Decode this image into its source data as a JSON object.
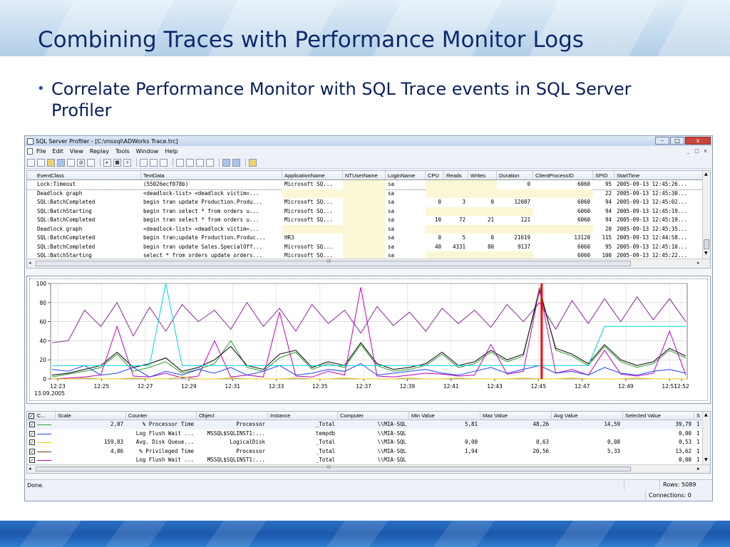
{
  "slide": {
    "title": "Combining Traces with Performance Monitor Logs",
    "bullet": "Correlate Performance Monitor with SQL Trace events in SQL Server Profiler"
  },
  "window": {
    "title": "SQL Server Profiler - [C:\\mssql\\ADWorks Trace.trc]",
    "buttons": {
      "minimize": "–",
      "maximize": "□",
      "close": "x"
    },
    "mdi_buttons": [
      "_",
      "□",
      "x"
    ],
    "menu": [
      "File",
      "Edit",
      "View",
      "Replay",
      "Tools",
      "Window",
      "Help"
    ],
    "toolbar_icons": [
      "save-icon",
      "new-trace-icon",
      "open-icon",
      "open-table-icon",
      "properties-icon",
      "find-icon",
      "clear-icon",
      "run-icon",
      "stop-icon",
      "pause-icon",
      "step-icon",
      "breakpoint-icon",
      "replay-icon",
      "columns-icon",
      "filter-icon",
      "group-icon",
      "monitor-icon",
      "help-icon"
    ]
  },
  "trace_grid": {
    "columns": [
      "EventClass",
      "TextData",
      "ApplicationName",
      "NTUserName",
      "LoginName",
      "CPU",
      "Reads",
      "Writes",
      "Duration",
      "ClientProcessID",
      "SPID",
      "StartTime"
    ],
    "rows": [
      [
        "Lock:Timeout",
        "(55026ecf078b)",
        "Microsoft SQ...",
        "",
        "sa",
        "",
        "",
        "",
        "0",
        "6060",
        "95",
        "2005-09-13 12:45:26..."
      ],
      [
        "Deadlock graph",
        "<deadlock-list>  <deadlock victim=...",
        "",
        "",
        "sa",
        "",
        "",
        "",
        "",
        "",
        "22",
        "2005-09-13 12:45:30..."
      ],
      [
        "SQL:BatchCompleted",
        "begin tran  update Production.Produ...",
        "Microsoft SQ...",
        "",
        "sa",
        "0",
        "3",
        "0",
        "12087",
        "6060",
        "94",
        "2005-09-13 12:45:02..."
      ],
      [
        "SQL:BatchStarting",
        "begin tran  select * from orders  u...",
        "Microsoft SQ...",
        "",
        "sa",
        "",
        "",
        "",
        "",
        "6060",
        "94",
        "2005-09-13 12:45:19..."
      ],
      [
        "SQL:BatchCompleted",
        "begin tran  select * from orders  u...",
        "Microsoft SQ...",
        "",
        "sa",
        "10",
        "72",
        "21",
        "121",
        "6060",
        "94",
        "2005-09-13 12:45:19..."
      ],
      [
        "Deadlock graph",
        "<deadlock-list>  <deadlock victim=...",
        "",
        "",
        "sa",
        "",
        "",
        "",
        "",
        "",
        "20",
        "2005-09-13 12:45:35..."
      ],
      [
        "SQL:BatchCompleted",
        "begin tran;update Production.Produc...",
        "HR3",
        "",
        "sa",
        "0",
        "5",
        "0",
        "21619",
        "13120",
        "115",
        "2005-09-13 12:44:58..."
      ],
      [
        "SQL:BatchCompleted",
        "begin tran  update Sales.SpecialOff...",
        "Microsoft SQ...",
        "",
        "sa",
        "40",
        "4331",
        "80",
        "9137",
        "6060",
        "95",
        "2005-09-13 12:45:10..."
      ],
      [
        "SQL:BatchStarting",
        "select * from orders  update orders...",
        "Microsoft SQ...",
        "",
        "sa",
        "",
        "",
        "",
        "",
        "6060",
        "100",
        "2005-09-13 12:45:22..."
      ]
    ],
    "scroll_grip": "III"
  },
  "chart_data": {
    "type": "line",
    "title": "",
    "xlabel": "",
    "ylabel": "",
    "ylim": [
      0,
      100
    ],
    "yticks": [
      "0",
      "20",
      "40",
      "60",
      "80",
      "100"
    ],
    "x_ticks": [
      "12:23",
      "12:25",
      "12:27",
      "12:29",
      "12:31",
      "12:33",
      "12:35",
      "12:37",
      "12:39",
      "12:41",
      "12:43",
      "12:45",
      "12:47",
      "12:49",
      "12:51",
      "12:52"
    ],
    "date_label": "13.09.2005",
    "grid": true,
    "legend": "none",
    "cursor_at": "12:45",
    "colors": {
      "cursor": "#ff0000",
      "green": "#2e9a2e",
      "magenta": "#c000c0",
      "purple": "#8a2a9a",
      "black": "#000000",
      "blue": "#2040ff",
      "cyan": "#00d0e8",
      "yellow": "#e8c800",
      "brown": "#6b3a1e"
    },
    "series": [
      {
        "color": "#8a2a9a",
        "values": [
          38,
          40,
          72,
          55,
          80,
          45,
          75,
          50,
          78,
          60,
          72,
          52,
          80,
          55,
          74,
          50,
          78,
          58,
          72,
          48,
          76,
          56,
          70,
          50,
          74,
          58,
          72,
          54,
          78,
          60,
          80,
          52,
          82,
          58,
          84,
          60,
          86,
          62,
          84,
          60
        ]
      },
      {
        "color": "#2e9a2e",
        "values": [
          2,
          5,
          8,
          12,
          26,
          8,
          12,
          18,
          6,
          10,
          16,
          40,
          12,
          8,
          22,
          28,
          10,
          16,
          12,
          36,
          14,
          8,
          10,
          14,
          26,
          12,
          16,
          28,
          18,
          24,
          96,
          30,
          24,
          14,
          34,
          18,
          12,
          16,
          30,
          22
        ]
      },
      {
        "color": "#000000",
        "values": [
          4,
          6,
          10,
          14,
          28,
          12,
          16,
          22,
          8,
          12,
          20,
          34,
          14,
          10,
          26,
          30,
          12,
          18,
          14,
          38,
          16,
          10,
          12,
          16,
          28,
          14,
          18,
          30,
          20,
          26,
          92,
          32,
          26,
          16,
          36,
          20,
          14,
          18,
          32,
          24
        ]
      },
      {
        "color": "#c000c0",
        "values": [
          0,
          1,
          2,
          4,
          55,
          3,
          2,
          6,
          1,
          3,
          40,
          2,
          4,
          2,
          70,
          3,
          2,
          8,
          4,
          96,
          3,
          2,
          4,
          6,
          5,
          3,
          4,
          36,
          5,
          8,
          94,
          6,
          10,
          4,
          30,
          5,
          3,
          6,
          50,
          4
        ]
      },
      {
        "color": "#2040ff",
        "values": [
          10,
          8,
          14,
          4,
          6,
          12,
          2,
          8,
          4,
          10,
          6,
          12,
          4,
          8,
          14,
          4,
          6,
          10,
          8,
          16,
          4,
          6,
          8,
          10,
          6,
          4,
          8,
          12,
          6,
          10,
          14,
          6,
          8,
          4,
          12,
          6,
          4,
          8,
          10,
          6
        ]
      },
      {
        "color": "#00d0e8",
        "values": [
          14,
          14,
          14,
          14,
          14,
          14,
          14,
          100,
          14,
          14,
          14,
          14,
          14,
          14,
          14,
          14,
          14,
          14,
          14,
          14,
          14,
          14,
          14,
          14,
          14,
          14,
          14,
          14,
          14,
          14,
          14,
          14,
          14,
          14,
          55,
          55,
          55,
          55,
          55,
          55
        ]
      },
      {
        "color": "#e8c800",
        "values": [
          0,
          0,
          1,
          0,
          0,
          1,
          0,
          0,
          2,
          0,
          0,
          1,
          0,
          0,
          0,
          1,
          0,
          0,
          1,
          0,
          0,
          0,
          1,
          0,
          0,
          1,
          0,
          0,
          0,
          1,
          0,
          0,
          1,
          0,
          0,
          0,
          1,
          0,
          0,
          0
        ]
      }
    ]
  },
  "counters": {
    "columns": [
      "C...",
      "Scale",
      "Counter",
      "Object",
      "Instance",
      "Computer",
      "Min Value",
      "Max Value",
      "Avg Value",
      "Selected Value",
      "S"
    ],
    "rows": [
      {
        "color": "#2e9a2e",
        "scale": "2,07",
        "counter": "% Processor Time",
        "object": "Processor",
        "instance": "_Total",
        "computer": "\\\\MIA-SQL",
        "min": "5,81",
        "max": "48,26",
        "avg": "14,59",
        "selected": "39,79",
        "s": "1"
      },
      {
        "color": "#2040ff",
        "scale": "",
        "counter": "Log Flush Wait ...",
        "object": "MSSQL$SQLINST1:...",
        "instance": "tempdb",
        "computer": "\\\\MIA-SQL",
        "min": "",
        "max": "",
        "avg": "",
        "selected": "0,00",
        "s": "1"
      },
      {
        "color": "#e8c800",
        "scale": "159,83",
        "counter": "Avg. Disk Queue...",
        "object": "LogicalDisk",
        "instance": "_Total",
        "computer": "\\\\MIA-SQL",
        "min": "0,00",
        "max": "0,63",
        "avg": "0,08",
        "selected": "0,53",
        "s": "1"
      },
      {
        "color": "#6b3a1e",
        "scale": "4,86",
        "counter": "% Privileged Time",
        "object": "Processor",
        "instance": "_Total",
        "computer": "\\\\MIA-SQL",
        "min": "1,94",
        "max": "20,56",
        "avg": "5,33",
        "selected": "13,62",
        "s": "1"
      },
      {
        "color": "#c000c0",
        "scale": "",
        "counter": "Log Flush Wait ...",
        "object": "MSSQL$SQLINST1:...",
        "instance": "_Total",
        "computer": "\\\\MIA-SQL",
        "min": "",
        "max": "",
        "avg": "",
        "selected": "0,00",
        "s": "1"
      }
    ],
    "scroll_grip": "III"
  },
  "status": {
    "text": "Done.",
    "ln_col": "",
    "rows": "Rows: 5089",
    "connections": "Connections: 0"
  }
}
